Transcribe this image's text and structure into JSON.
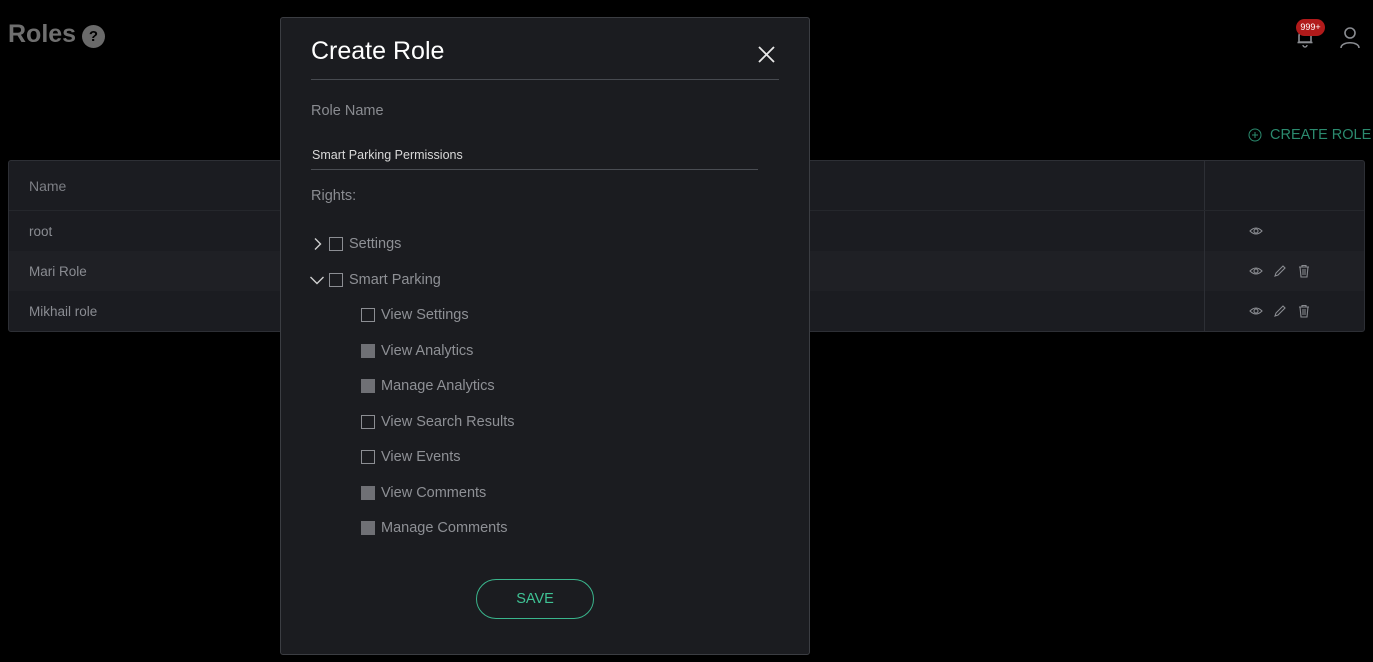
{
  "page": {
    "title": "Roles",
    "help_glyph": "?"
  },
  "header": {
    "notification_count": "999+",
    "icons": [
      "bell-icon",
      "user-icon"
    ]
  },
  "toolbar": {
    "create_role_label": "CREATE ROLE"
  },
  "table": {
    "columns": [
      "Name",
      ""
    ],
    "rows": [
      {
        "name": "root",
        "actions": [
          "view"
        ]
      },
      {
        "name": "Mari Role",
        "actions": [
          "view",
          "edit",
          "delete"
        ]
      },
      {
        "name": "Mikhail role",
        "actions": [
          "view",
          "edit",
          "delete"
        ]
      }
    ]
  },
  "modal": {
    "title": "Create Role",
    "role_name_label": "Role Name",
    "role_name_value": "Smart Parking Permissions",
    "rights_label": "Rights:",
    "groups": [
      {
        "label": "Settings",
        "expanded": false,
        "checked": false
      },
      {
        "label": "Smart Parking",
        "expanded": true,
        "checked": false,
        "children": [
          {
            "label": "View Settings",
            "state": "unchecked"
          },
          {
            "label": "View Analytics",
            "state": "filled"
          },
          {
            "label": "Manage Analytics",
            "state": "filled"
          },
          {
            "label": "View Search Results",
            "state": "unchecked"
          },
          {
            "label": "View Events",
            "state": "unchecked"
          },
          {
            "label": "View Comments",
            "state": "filled"
          },
          {
            "label": "Manage Comments",
            "state": "filled"
          }
        ]
      }
    ],
    "save_label": "SAVE"
  },
  "colors": {
    "accent": "#3ab58c",
    "link_accent": "#2b8a6e",
    "badge": "#b11a1a",
    "modal_bg": "#1b1c20"
  }
}
